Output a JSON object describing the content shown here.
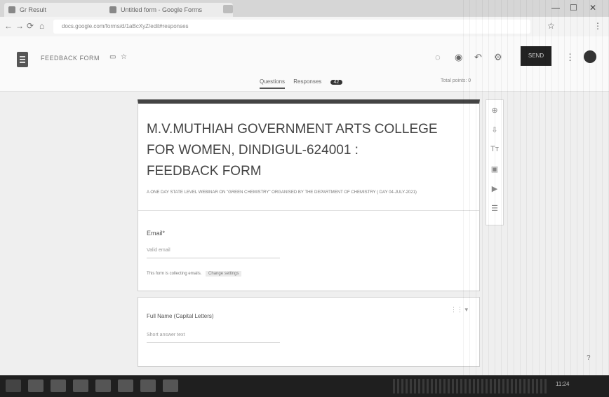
{
  "browser": {
    "tabs": [
      {
        "label": "Gr Result",
        "close": "×"
      },
      {
        "label": "Untitled form - Google Forms",
        "close": "×"
      }
    ],
    "new_tab": "+",
    "window_controls": [
      "—",
      "☐",
      "✕"
    ],
    "address": "docs.google.com/forms/d/1aBcXyZ/edit#responses",
    "nav": [
      "←",
      "→",
      "⟳",
      "⌂"
    ],
    "extensions": [
      "☆",
      "⋮"
    ]
  },
  "forms_header": {
    "form_title": "FEEDBACK FORM",
    "icons": [
      "folder-icon",
      "star-icon"
    ],
    "send_label": "SEND",
    "tabs": [
      {
        "label": "Questions",
        "active": true
      },
      {
        "label": "Responses",
        "count": "42"
      }
    ],
    "total_points": "Total points: 0"
  },
  "form": {
    "heading_line1": "M.V.MUTHIAH GOVERNMENT ARTS COLLEGE",
    "heading_line2": "FOR WOMEN, DINDIGUL-624001  :",
    "heading_line3": "FEEDBACK FORM",
    "description": "A ONE DAY STATE LEVEL WEBINAR ON \"GREEN CHEMISTRY\" ORGANISED BY THE DEPARTMENT OF CHEMISTRY ( DAY 04-JULY-2021)",
    "q1_label": "Email",
    "q1_required": "*",
    "q1_placeholder": "Valid email",
    "q1_note": "This form is collecting emails.",
    "q1_note_tag": "Change settings",
    "q2_label": "Full Name (Capital Letters)",
    "q2_placeholder": "Short answer text",
    "q2_icons": "⋮⋮  ▾"
  },
  "side_toolbar": {
    "tools": [
      "⊕",
      "⇩",
      "Tт",
      "▣",
      "▶",
      "☰"
    ]
  },
  "help": "?",
  "taskbar": {
    "clock": "11:24"
  }
}
